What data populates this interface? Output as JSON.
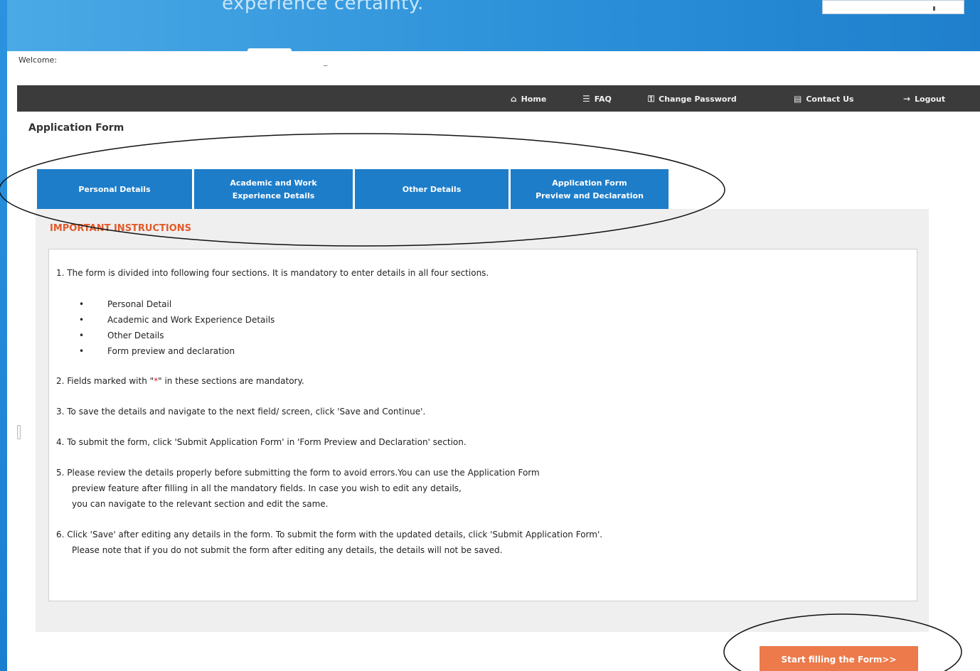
{
  "banner": {
    "tagline": "experience certainty."
  },
  "header": {
    "welcome_label": "Welcome:",
    "welcome_user": "_"
  },
  "nav": {
    "items": [
      {
        "label": "Home",
        "icon": "home-icon",
        "glyph": "⌂"
      },
      {
        "label": "FAQ",
        "icon": "faq-icon",
        "glyph": "☰"
      },
      {
        "label": "Change Password",
        "icon": "key-icon",
        "glyph": "⚿"
      },
      {
        "label": "Contact Us",
        "icon": "contact-icon",
        "glyph": "▤"
      },
      {
        "label": "Logout",
        "icon": "logout-icon",
        "glyph": "→"
      }
    ]
  },
  "page": {
    "title": "Application Form"
  },
  "tabs": [
    {
      "line1": "Personal Details",
      "line2": ""
    },
    {
      "line1": "Academic and Work",
      "line2": "Experience Details"
    },
    {
      "line1": "Other Details",
      "line2": ""
    },
    {
      "line1": "Application Form",
      "line2": "Preview and Declaration"
    }
  ],
  "instructions": {
    "heading": "IMPORTANT INSTRUCTIONS",
    "item1": "1. The form is divided into following four sections. It is mandatory to enter details in all four sections.",
    "bullets": [
      "Personal Detail",
      "Academic and Work Experience Details",
      "Other Details",
      "Form preview and declaration"
    ],
    "item2_pre": "2. Fields marked with \"",
    "item2_star": "*",
    "item2_post": "\"  in these sections are mandatory.",
    "item3": "3. To save the details and navigate to the next field/ screen, click 'Save and Continue'.",
    "item4": "4. To submit the form, click 'Submit Application Form' in 'Form Preview and Declaration' section.",
    "item5_l1": "5. Please review the details properly before submitting the form to avoid errors.You can use the Application Form",
    "item5_l2": "preview feature after filling in all the mandatory fields. In case you wish to edit any details,",
    "item5_l3": "you can navigate to the relevant section and edit the same.",
    "item6_l1": "6. Click 'Save' after editing any details in the form. To submit the form with the updated details, click 'Submit Application Form'.",
    "item6_l2": "Please note that if you do not submit the form after editing any details, the details will not be saved."
  },
  "actions": {
    "start_label": "Start filling the Form>>"
  },
  "colors": {
    "tab_blue": "#1d7dc9",
    "heading_orange": "#e25a2a",
    "button_orange": "#ec7a4b",
    "navbar": "#3b3b3b"
  }
}
